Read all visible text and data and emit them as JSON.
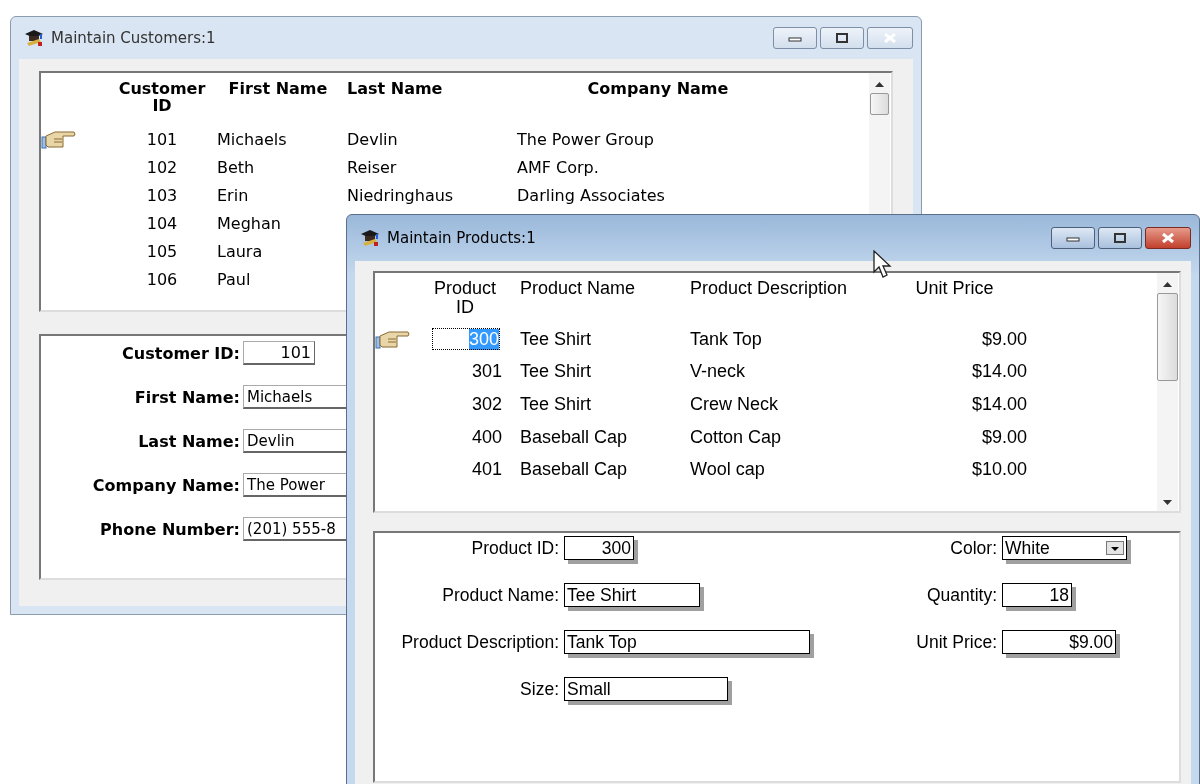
{
  "windows": [
    {
      "kind": "customers",
      "title": "Maintain Customers:1",
      "active": false,
      "table": {
        "columns": [
          "Customer ID",
          "First Name",
          "Last Name",
          "Company Name"
        ],
        "rows": [
          {
            "selected": true,
            "cells": [
              "101",
              "Michaels",
              "Devlin",
              "The Power Group"
            ]
          },
          {
            "selected": false,
            "cells": [
              "102",
              "Beth",
              "Reiser",
              "AMF Corp."
            ]
          },
          {
            "selected": false,
            "cells": [
              "103",
              "Erin",
              "Niedringhaus",
              "Darling Associates"
            ]
          },
          {
            "selected": false,
            "cells": [
              "104",
              "Meghan"
            ]
          },
          {
            "selected": false,
            "cells": [
              "105",
              "Laura"
            ]
          },
          {
            "selected": false,
            "cells": [
              "106",
              "Paul"
            ]
          }
        ]
      },
      "form": {
        "fields": [
          {
            "kind": "number",
            "label": "Customer ID:",
            "value": "101"
          },
          {
            "kind": "text",
            "label": "First Name:",
            "value": "Michaels"
          },
          {
            "kind": "text",
            "label": "Last Name:",
            "value": "Devlin"
          },
          {
            "kind": "text",
            "label": "Company Name:",
            "value": "The Power"
          },
          {
            "kind": "text",
            "label": "Phone Number:",
            "value": "(201) 555-8"
          }
        ]
      }
    },
    {
      "kind": "products",
      "title": "Maintain Products:1",
      "active": true,
      "table": {
        "columns": [
          "Product ID",
          "Product Name",
          "Product Description",
          "Unit Price"
        ],
        "rows": [
          {
            "selected": true,
            "cells": [
              "300",
              "Tee Shirt",
              "Tank Top",
              "$9.00"
            ]
          },
          {
            "selected": false,
            "cells": [
              "301",
              "Tee Shirt",
              "V-neck",
              "$14.00"
            ]
          },
          {
            "selected": false,
            "cells": [
              "302",
              "Tee Shirt",
              "Crew Neck",
              "$14.00"
            ]
          },
          {
            "selected": false,
            "cells": [
              "400",
              "Baseball Cap",
              "Cotton Cap",
              "$9.00"
            ]
          },
          {
            "selected": false,
            "cells": [
              "401",
              "Baseball Cap",
              "Wool cap",
              "$10.00"
            ]
          }
        ]
      },
      "form": {
        "fields": [
          {
            "kind": "number",
            "label": "Product ID:",
            "value": "300"
          },
          {
            "kind": "dropdown",
            "label": "Color:",
            "value": "White"
          },
          {
            "kind": "text",
            "label": "Product Name:",
            "value": "Tee Shirt"
          },
          {
            "kind": "number",
            "label": "Quantity:",
            "value": "18"
          },
          {
            "kind": "text",
            "label": "Product Description:",
            "value": "Tank Top"
          },
          {
            "kind": "number",
            "label": "Unit Price:",
            "value": "$9.00"
          },
          {
            "kind": "text",
            "label": "Size:",
            "value": "Small"
          }
        ]
      }
    }
  ]
}
